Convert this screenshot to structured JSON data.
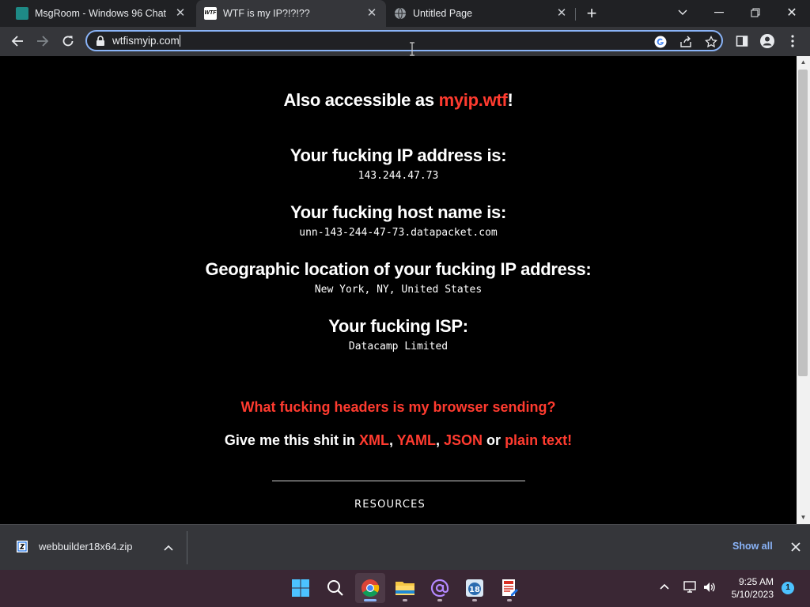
{
  "browser": {
    "tabs": [
      {
        "label": "MsgRoom - Windows 96 Chat",
        "icon": "msgroom-favicon"
      },
      {
        "label": "WTF is my IP?!?!??",
        "icon": "wtf-favicon",
        "active": true
      },
      {
        "label": "Untitled Page",
        "icon": "globe-icon"
      }
    ],
    "new_tab_glyph": "+",
    "address": "wtfismyip.com"
  },
  "page": {
    "also_prefix": "Also accessible as ",
    "also_link": "myip.wtf",
    "also_suffix": "!",
    "ip_heading": "Your fucking IP address is:",
    "ip_value": "143.244.47.73",
    "host_heading": "Your fucking host name is:",
    "host_value": "unn-143-244-47-73.datapacket.com",
    "geo_heading": "Geographic location of your fucking IP address:",
    "geo_value": "New York, NY, United States",
    "isp_heading": "Your fucking ISP:",
    "isp_value": "Datacamp Limited",
    "headers_link": "What fucking headers is my browser sending?",
    "give_prefix": "Give me this shit in ",
    "formats": [
      "XML",
      "YAML",
      "JSON",
      "plain text!"
    ],
    "sep_comma": ", ",
    "sep_or": " or ",
    "resources": "RESOURCES"
  },
  "downloads": {
    "file": "webbuilder18x64.zip",
    "show_all": "Show all"
  },
  "taskbar": {
    "time": "9:25 AM",
    "date": "5/10/2023",
    "notifications": "1",
    "colors": {
      "accent": "#8ab4f8",
      "link_red": "#ff3b2f",
      "taskbar": "#3a2734"
    }
  }
}
